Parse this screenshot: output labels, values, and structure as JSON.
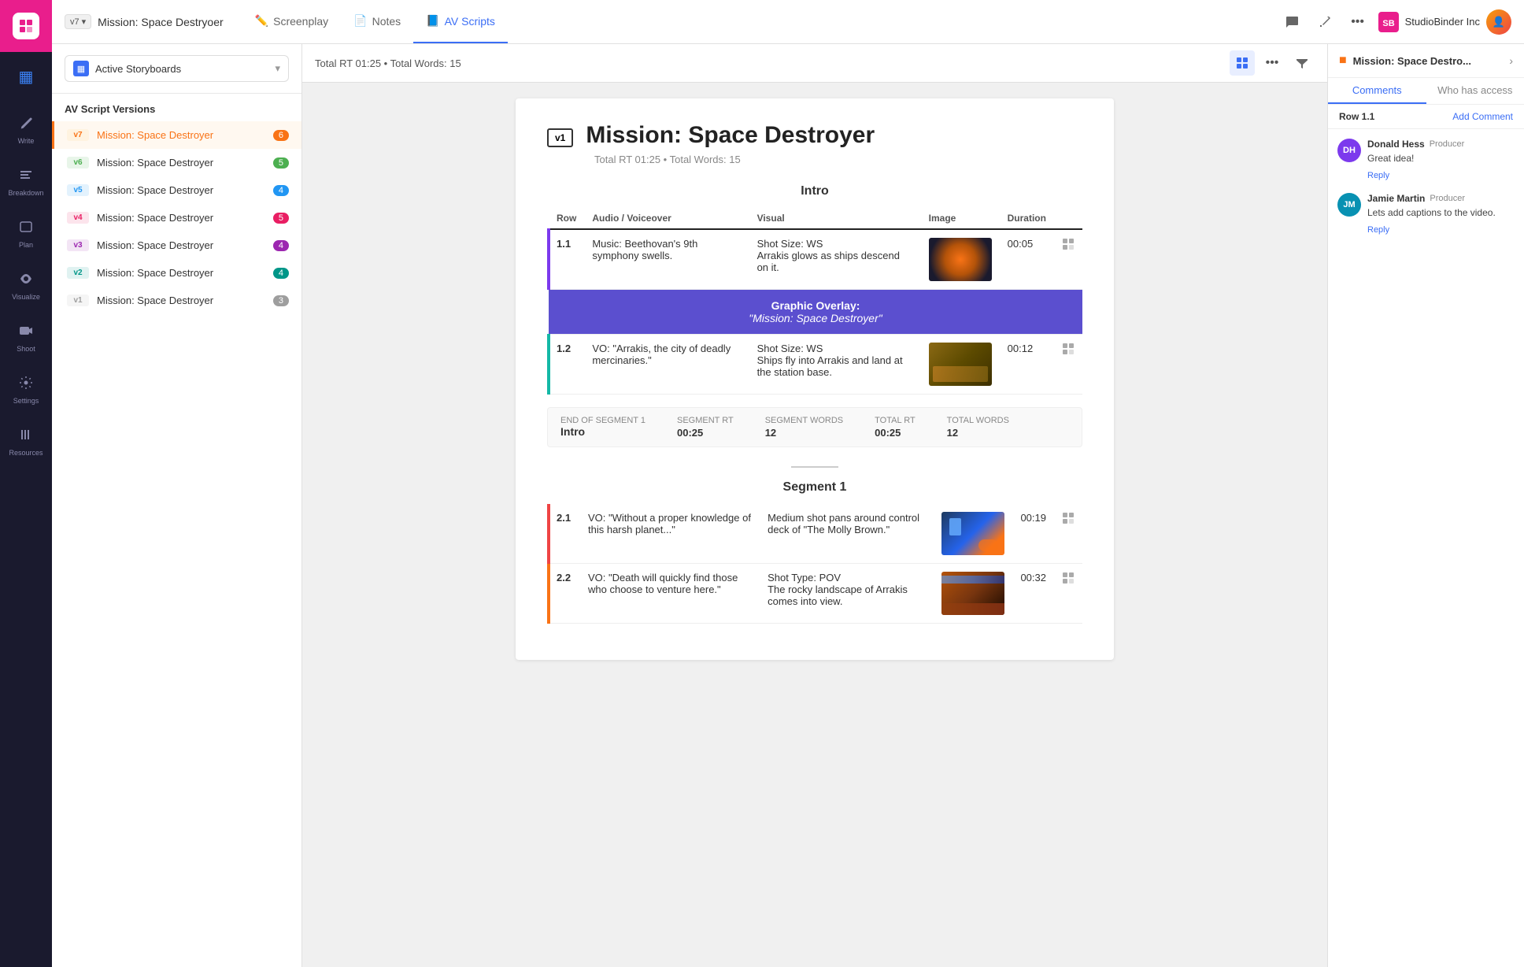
{
  "app": {
    "logo_label": "SB",
    "logo_color": "#e91e8c"
  },
  "nav": {
    "items": [
      {
        "id": "storyboard",
        "label": "SB",
        "icon": "▦",
        "active": true
      },
      {
        "id": "write",
        "label": "Write",
        "icon": "✏️"
      },
      {
        "id": "breakdown",
        "label": "Breakdown",
        "icon": "⚡"
      },
      {
        "id": "plan",
        "label": "Plan",
        "icon": "📅"
      },
      {
        "id": "visualize",
        "label": "Visualize",
        "icon": "👁"
      },
      {
        "id": "shoot",
        "label": "Shoot",
        "icon": "🎬"
      },
      {
        "id": "settings",
        "label": "Settings",
        "icon": "⚙"
      },
      {
        "id": "resources",
        "label": "Resources",
        "icon": "📊"
      }
    ]
  },
  "topbar": {
    "version": "v7",
    "project_title": "Mission: Space Destryoer",
    "tabs": [
      {
        "id": "screenplay",
        "label": "Screenplay",
        "icon": "✏️",
        "active": false
      },
      {
        "id": "notes",
        "label": "Notes",
        "icon": "📄",
        "active": false
      },
      {
        "id": "avscripts",
        "label": "AV Scripts",
        "icon": "📘",
        "active": true
      }
    ],
    "company": "StudioBinder Inc",
    "comment_icon": "💬",
    "share_icon": "↗",
    "more_icon": "···"
  },
  "toolbar": {
    "rt_info": "Total RT 01:25 • Total Words: 15",
    "storyboard_label": "Active Storyboards",
    "storyboard_icon": "▦"
  },
  "versions": {
    "header": "AV Script Versions",
    "items": [
      {
        "tag": "v7",
        "tag_class": "v7",
        "name": "Mission: Space Destroyer",
        "count": "6",
        "active": true
      },
      {
        "tag": "v6",
        "tag_class": "v6",
        "name": "Mission: Space Destroyer",
        "count": "5",
        "active": false
      },
      {
        "tag": "v5",
        "tag_class": "v5",
        "name": "Mission: Space Destroyer",
        "count": "4",
        "active": false
      },
      {
        "tag": "v4",
        "tag_class": "v4",
        "name": "Mission: Space Destroyer",
        "count": "5",
        "active": false
      },
      {
        "tag": "v3",
        "tag_class": "v3",
        "name": "Mission: Space Destroyer",
        "count": "4",
        "active": false
      },
      {
        "tag": "v2",
        "tag_class": "v2",
        "name": "Mission: Space Destroyer",
        "count": "4",
        "active": false
      },
      {
        "tag": "v1",
        "tag_class": "v1",
        "name": "Mission: Space Destroyer",
        "count": "3",
        "active": false
      }
    ]
  },
  "script": {
    "version_badge": "v1",
    "title": "Mission: Space Destroyer",
    "subtitle": "Total RT 01:25 • Total Words: 15",
    "segments": [
      {
        "id": "intro",
        "title": "Intro",
        "rows": [
          {
            "id": "1.1",
            "border_color": "purple",
            "audio": "Music: Beethovan's 9th symphony swells.",
            "visual": "Shot Size: WS\nArrakis glows as ships descend on it.",
            "image_color": "#b5651d",
            "image_label": "planet",
            "duration": "00:05"
          }
        ],
        "overlay": {
          "label": "Graphic Overlay:",
          "value": "\"Mission: Space Destroyer\""
        },
        "rows2": [
          {
            "id": "1.2",
            "border_color": "teal",
            "audio": "VO: \"Arrakis, the city of deadly mercinaries.\"",
            "visual": "Shot Size: WS\nShips fly into Arrakis and land at the station base.",
            "image_color": "#8B6914",
            "image_label": "ships",
            "duration": "00:12"
          }
        ],
        "footer": {
          "end_label": "END OF SEGMENT 1",
          "end_value": "Intro",
          "segment_rt_label": "SEGMENT RT",
          "segment_rt": "00:25",
          "segment_words_label": "SEGMENT WORDS",
          "segment_words": "12",
          "total_rt_label": "TOTAL RT",
          "total_rt": "00:25",
          "total_words_label": "TOTAL WORDS",
          "total_words": "12"
        }
      },
      {
        "id": "segment1",
        "title": "Segment 1",
        "rows": [
          {
            "id": "2.1",
            "border_color": "red",
            "audio": "VO: \"Without a proper knowledge of this harsh planet...\"",
            "visual": "Medium shot pans around control deck of \"The Molly Brown.\"",
            "image_color": "#2563eb",
            "image_label": "deck",
            "duration": "00:19"
          },
          {
            "id": "2.2",
            "border_color": "orange",
            "audio": "VO: \"Death will quickly find those who choose to venture here.\"",
            "visual": "Shot Type: POV\nThe rocky landscape of Arrakis comes into view.",
            "image_color": "#b45309",
            "image_label": "landscape",
            "duration": "00:32"
          }
        ]
      }
    ]
  },
  "comments_panel": {
    "title": "Mission: Space Destro...",
    "expand_icon": "›",
    "tabs": [
      {
        "id": "comments",
        "label": "Comments",
        "active": true
      },
      {
        "id": "who_has_access",
        "label": "Who has access",
        "active": false
      }
    ],
    "row_label": "Row 1.1",
    "add_comment_label": "Add Comment",
    "comments": [
      {
        "id": "c1",
        "author": "Donald Hess",
        "role": "Producer",
        "avatar_color": "#7c3aed",
        "avatar_initials": "DH",
        "text": "Great idea!",
        "reply_label": "Reply"
      },
      {
        "id": "c2",
        "author": "Jamie Martin",
        "role": "Producer",
        "avatar_color": "#0891b2",
        "avatar_initials": "JM",
        "text": "Lets add captions to the video.",
        "reply_label": "Reply"
      }
    ]
  }
}
